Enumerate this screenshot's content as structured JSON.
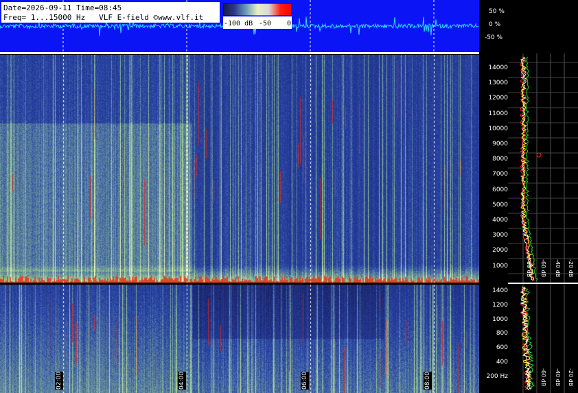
{
  "header": {
    "line1": "Date=2026-09-11 Time=08:45",
    "line2": "Freq= 1...15000 Hz   VLF E-field ©www.vlf.it"
  },
  "colorbar": {
    "labels": [
      "-100 dB",
      "-50",
      "0"
    ],
    "stops": [
      "#1a1a40",
      "#2a3a8a",
      "#6a9ab8",
      "#e8f0c0",
      "#d8d8d8",
      "#ff2010",
      "#ff0000"
    ]
  },
  "waveform": {
    "percent_labels": [
      "50 %",
      "0 %",
      "-50 %"
    ],
    "line_color": "#30d8ff"
  },
  "spectrogram": {
    "time_labels": [
      "02:00",
      "04:00",
      "06:00",
      "08:00"
    ],
    "freq_top_labels": [
      "14000",
      "13000",
      "12000",
      "11000",
      "10000",
      "9000",
      "8000",
      "7000",
      "6000",
      "5000",
      "4000",
      "3000",
      "2000",
      "1000"
    ],
    "freq_bot_labels": [
      "1400",
      "1200",
      "1000",
      "800",
      "600",
      "400",
      "200 Hz"
    ]
  },
  "spectrum_panel": {
    "db_labels": [
      "-80 dB",
      "-60 dB",
      "-40 dB",
      "-20 dB"
    ],
    "colors": {
      "green": "#22dd22",
      "red": "#ff2020",
      "yellow": "#ffff30",
      "white": "#ffffff"
    }
  },
  "colors": {
    "top_panel": "#0a14f5",
    "background": "#000000"
  }
}
